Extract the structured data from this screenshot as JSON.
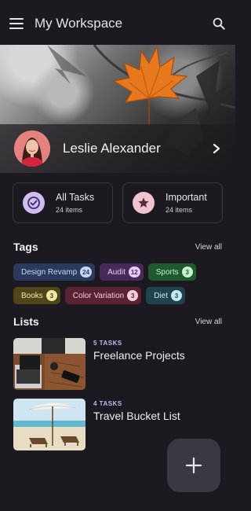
{
  "appbar": {
    "title": "My Workspace",
    "menu_icon": "menu-icon",
    "search_icon": "search-icon"
  },
  "profile": {
    "name": "Leslie Alexander"
  },
  "cards": [
    {
      "title": "All Tasks",
      "subtitle": "24 items",
      "icon": "check-circle-icon",
      "color": "#cdbdf0"
    },
    {
      "title": "Important",
      "subtitle": "24 items",
      "icon": "star-icon",
      "color": "#f1c2cf"
    }
  ],
  "tags_section": {
    "title": "Tags",
    "view_all": "View all"
  },
  "tags": [
    {
      "label": "Design Revamp",
      "count": "24",
      "bg": "#293a5c",
      "fg": "#c6d6f5",
      "badge_bg": "#c6d6f5",
      "badge_fg": "#293a5c"
    },
    {
      "label": "Audit",
      "count": "12",
      "bg": "#472a5a",
      "fg": "#e6ccf5",
      "badge_bg": "#e6ccf5",
      "badge_fg": "#472a5a"
    },
    {
      "label": "Sports",
      "count": "3",
      "bg": "#1f5a2c",
      "fg": "#c9f0cf",
      "badge_bg": "#c9f0cf",
      "badge_fg": "#1f5a2c"
    },
    {
      "label": "Books",
      "count": "3",
      "bg": "#4f4518",
      "fg": "#f1e6a8",
      "badge_bg": "#f1e6a8",
      "badge_fg": "#4f4518"
    },
    {
      "label": "Color Variation",
      "count": "3",
      "bg": "#5a2334",
      "fg": "#f3ccd6",
      "badge_bg": "#f3ccd6",
      "badge_fg": "#5a2334"
    },
    {
      "label": "Diet",
      "count": "3",
      "bg": "#1f4450",
      "fg": "#c7e8f0",
      "badge_bg": "#c7e8f0",
      "badge_fg": "#1f4450"
    }
  ],
  "lists_section": {
    "title": "Lists",
    "view_all": "View all"
  },
  "lists": [
    {
      "count_label": "5 TASKS",
      "title": "Freelance Projects"
    },
    {
      "count_label": "4 TASKS",
      "title": "Travel Bucket List"
    }
  ],
  "fab": {
    "icon": "plus-icon"
  }
}
